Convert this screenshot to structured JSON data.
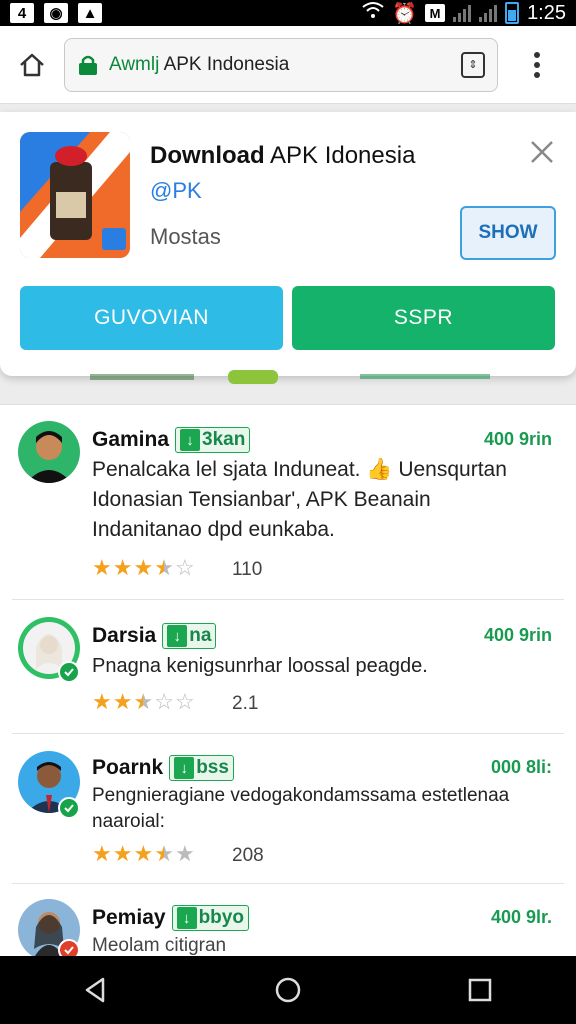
{
  "statusbar": {
    "notif_num": "4",
    "time": "1:25",
    "icon_m": "M"
  },
  "urlbar": {
    "url_green": "Awmlj",
    "url_rest": "APK Indonesia"
  },
  "banner": {
    "title_bold": "Download",
    "title_rest": "APK Idonesia",
    "subtitle": "@PK",
    "meta": "Mostas",
    "show_label": "SHOW",
    "btn_blue_label": "GUVOVIAN",
    "btn_green_label": "SSPR"
  },
  "reviews": [
    {
      "name": "Gamina",
      "tag": "3kan",
      "time": "400 9rin",
      "text": "Penalcaka lel sjata Induneat. 👍 Uensqurtan Idonasian Tensianbar', APK Beanain Indanitanao dpd eunkaba.",
      "rating": 3.5,
      "count": "110"
    },
    {
      "name": "Darsia",
      "tag": "na",
      "time": "400 9rin",
      "text": "Pnagna kenigsunrhar loossal peagde.",
      "rating": 2.5,
      "count": "2.1"
    },
    {
      "name": "Poarnk",
      "tag": "bss",
      "time": "000 8li:",
      "text": "Pengnieragiane vedogakondamssama estetlenaa naaroial:",
      "rating": 3.5,
      "count": "208"
    },
    {
      "name": "Pemiay",
      "tag": "bbyo",
      "time": "400 9lr.",
      "text": "Meolam citigran",
      "rating": 0,
      "count": ""
    }
  ],
  "colors": {
    "green": "#14b26a",
    "blue": "#2ebbe6",
    "star": "#f4a11d"
  }
}
